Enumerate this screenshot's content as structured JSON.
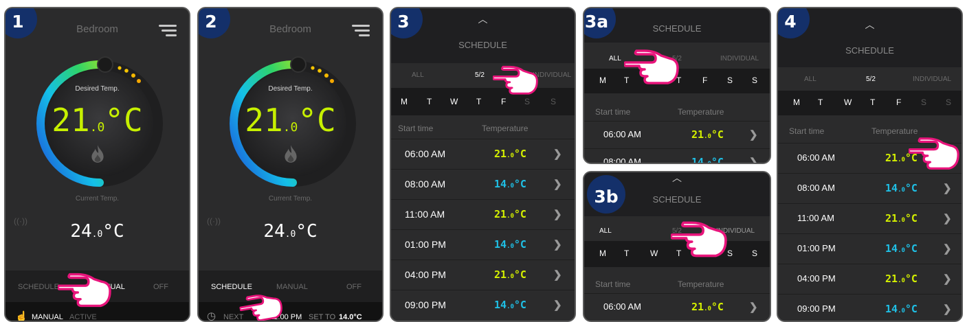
{
  "colors": {
    "accent_yellow": "#d4f000",
    "accent_cyan": "#1fc0e6",
    "step_badge": "#14306a",
    "hand": "#e8147b",
    "panel": "#2b2b2c"
  },
  "panel1": {
    "step": "1",
    "room": "Bedroom",
    "desired_label": "Desired Temp.",
    "desired_int": "21",
    "desired_dec": ".0",
    "desired_unit": "°C",
    "current_label": "Current Temp.",
    "current_int": "24",
    "current_dec": ".0",
    "current_unit": "°C",
    "modes": {
      "schedule": "SCHEDULE",
      "manual": "MANUAL",
      "off": "OFF"
    },
    "status": {
      "mode": "MANUAL",
      "state": "ACTIVE"
    },
    "icons": [
      "menu-icon",
      "flame-icon",
      "wifi-signal-icon",
      "hand-icon",
      "pointing-hand-icon"
    ]
  },
  "panel2": {
    "step": "2",
    "room": "Bedroom",
    "desired_label": "Desired Temp.",
    "desired_int": "21",
    "desired_dec": ".0",
    "desired_unit": "°C",
    "current_label": "Current Temp.",
    "current_int": "24",
    "current_dec": ".0",
    "current_unit": "°C",
    "modes": {
      "schedule": "SCHEDULE",
      "manual": "MANUAL",
      "off": "OFF"
    },
    "status": {
      "next": "NEXT",
      "time": "11:00 PM",
      "set_to": "SET TO",
      "value": "14.0°C"
    },
    "icons": [
      "schedule-clock-icon",
      "chevron-down-icon"
    ]
  },
  "panel3": {
    "step": "3",
    "title": "SCHEDULE",
    "tabs": {
      "all": "ALL",
      "five_two": "5/2",
      "individual": "INDIVIDUAL"
    },
    "days": [
      "M",
      "T",
      "W",
      "T",
      "F",
      "S",
      "S"
    ],
    "headers": {
      "start": "Start time",
      "temp": "Temperature"
    },
    "rows": [
      {
        "time": "06:00 AM",
        "int": "21",
        "dec": ".0",
        "unit": "°C",
        "color": "yel"
      },
      {
        "time": "08:00 AM",
        "int": "14",
        "dec": ".0",
        "unit": "°C",
        "color": "cyan"
      },
      {
        "time": "11:00 AM",
        "int": "21",
        "dec": ".0",
        "unit": "°C",
        "color": "yel"
      },
      {
        "time": "01:00 PM",
        "int": "14",
        "dec": ".0",
        "unit": "°C",
        "color": "cyan"
      },
      {
        "time": "04:00 PM",
        "int": "21",
        "dec": ".0",
        "unit": "°C",
        "color": "yel"
      },
      {
        "time": "09:00 PM",
        "int": "14",
        "dec": ".0",
        "unit": "°C",
        "color": "cyan"
      }
    ]
  },
  "panel3a": {
    "step": "3a",
    "title": "SCHEDULE",
    "tabs": {
      "all": "ALL",
      "five_two": "5/2",
      "individual": "INDIVIDUAL"
    },
    "days": [
      "M",
      "T",
      "W",
      "T",
      "F",
      "S",
      "S"
    ],
    "headers": {
      "start": "Start time",
      "temp": "Temperature"
    },
    "rows": [
      {
        "time": "06:00 AM",
        "int": "21",
        "dec": ".0",
        "unit": "°C"
      },
      {
        "time": "08:00 AM",
        "int": "14",
        "dec": ".0",
        "unit": "°C"
      }
    ]
  },
  "panel3b": {
    "step": "3b",
    "title": "SCHEDULE",
    "tabs": {
      "all": "ALL",
      "five_two": "5/2",
      "individual": "INDIVIDUAL"
    },
    "days": [
      "M",
      "T",
      "W",
      "T",
      "F",
      "S",
      "S"
    ],
    "headers": {
      "start": "Start time",
      "temp": "Temperature"
    },
    "rows": [
      {
        "time": "06:00 AM",
        "int": "21",
        "dec": ".0",
        "unit": "°C"
      }
    ]
  },
  "panel4": {
    "step": "4",
    "title": "SCHEDULE",
    "tabs": {
      "all": "ALL",
      "five_two": "5/2",
      "individual": "INDIVIDUAL"
    },
    "days": [
      "M",
      "T",
      "W",
      "T",
      "F",
      "S",
      "S"
    ],
    "headers": {
      "start": "Start time",
      "temp": "Temperature"
    },
    "rows": [
      {
        "time": "06:00 AM",
        "int": "21",
        "dec": ".0",
        "unit": "°C"
      },
      {
        "time": "08:00 AM",
        "int": "14",
        "dec": ".0",
        "unit": "°C"
      },
      {
        "time": "11:00 AM",
        "int": "21",
        "dec": ".0",
        "unit": "°C"
      },
      {
        "time": "01:00 PM",
        "int": "14",
        "dec": ".0",
        "unit": "°C"
      },
      {
        "time": "04:00 PM",
        "int": "21",
        "dec": ".0",
        "unit": "°C"
      },
      {
        "time": "09:00 PM",
        "int": "14",
        "dec": ".0",
        "unit": "°C"
      }
    ]
  }
}
